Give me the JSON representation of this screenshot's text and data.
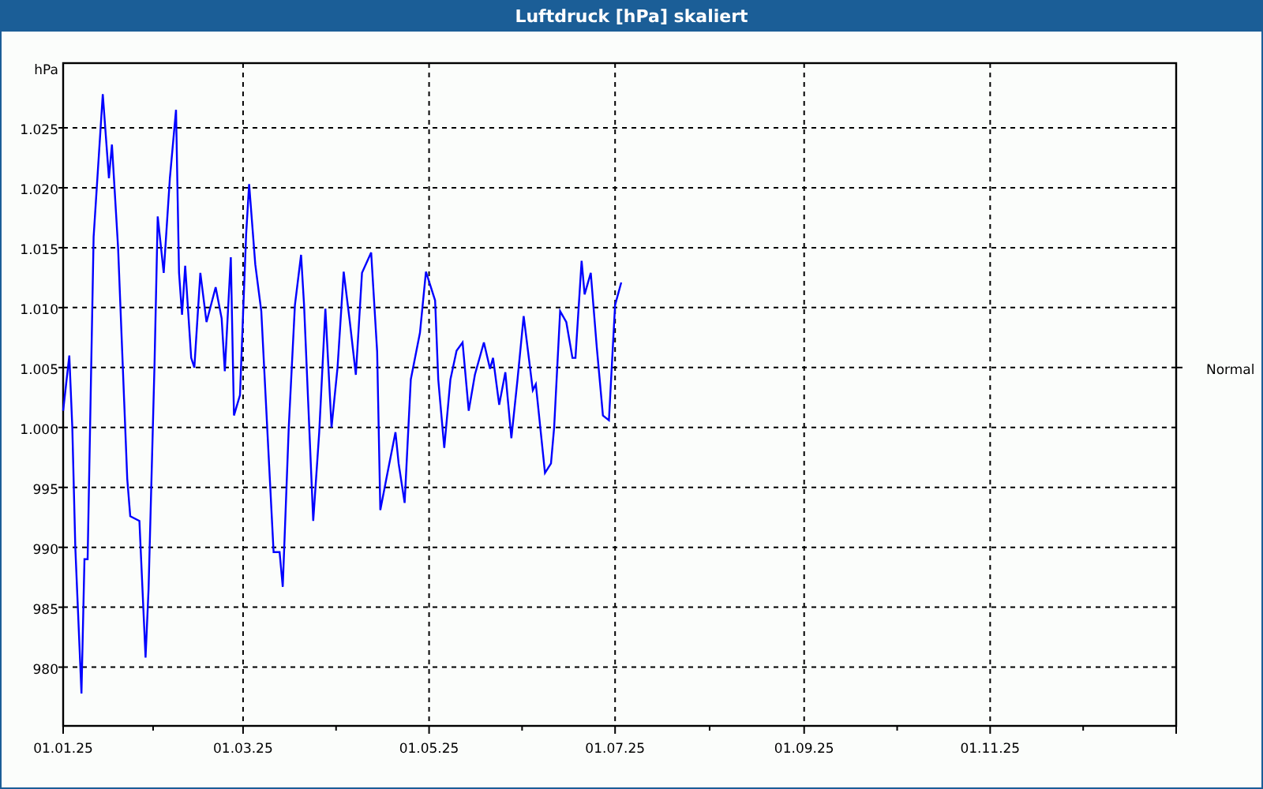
{
  "window": {
    "title": "Luftdruck [hPa] skaliert"
  },
  "chart": {
    "chart_data": {
      "type": "line",
      "ylabel": "hPa",
      "x": [
        "2025-01-01",
        "2025-01-03",
        "2025-01-04",
        "2025-01-05",
        "2025-01-07",
        "2025-01-08",
        "2025-01-09",
        "2025-01-11",
        "2025-01-14",
        "2025-01-16",
        "2025-01-17",
        "2025-01-19",
        "2025-01-22",
        "2025-01-23",
        "2025-01-26",
        "2025-01-28",
        "2025-01-29",
        "2025-01-31",
        "2025-02-01",
        "2025-02-03",
        "2025-02-05",
        "2025-02-07",
        "2025-02-08",
        "2025-02-09",
        "2025-02-10",
        "2025-02-12",
        "2025-02-13",
        "2025-02-15",
        "2025-02-17",
        "2025-02-20",
        "2025-02-22",
        "2025-02-23",
        "2025-02-25",
        "2025-02-26",
        "2025-02-28",
        "2025-03-02",
        "2025-03-03",
        "2025-03-05",
        "2025-03-07",
        "2025-03-09",
        "2025-03-11",
        "2025-03-13",
        "2025-03-14",
        "2025-03-16",
        "2025-03-18",
        "2025-03-20",
        "2025-03-21",
        "2025-03-24",
        "2025-03-26",
        "2025-03-28",
        "2025-03-30",
        "2025-04-01",
        "2025-04-03",
        "2025-04-05",
        "2025-04-07",
        "2025-04-09",
        "2025-04-12",
        "2025-04-14",
        "2025-04-15",
        "2025-04-17",
        "2025-04-20",
        "2025-04-21",
        "2025-04-23",
        "2025-04-25",
        "2025-04-28",
        "2025-04-30",
        "2025-05-03",
        "2025-05-04",
        "2025-05-06",
        "2025-05-08",
        "2025-05-10",
        "2025-05-12",
        "2025-05-14",
        "2025-05-16",
        "2025-05-19",
        "2025-05-21",
        "2025-05-22",
        "2025-05-24",
        "2025-05-26",
        "2025-05-28",
        "2025-05-30",
        "2025-06-01",
        "2025-06-04",
        "2025-06-05",
        "2025-06-08",
        "2025-06-10",
        "2025-06-11",
        "2025-06-13",
        "2025-06-15",
        "2025-06-17",
        "2025-06-18",
        "2025-06-20",
        "2025-06-21",
        "2025-06-23",
        "2025-06-25",
        "2025-06-27",
        "2025-06-29",
        "2025-07-01",
        "2025-07-03"
      ],
      "series": [
        {
          "color": "#0000ff",
          "values": [
            1001.4,
            1006,
            1000,
            990,
            977.8,
            989,
            989,
            1015.9,
            1027.8,
            1020.8,
            1023.6,
            1015,
            995.7,
            992.6,
            992.2,
            980.8,
            986.5,
            1005.4,
            1017.6,
            1012.9,
            1020.8,
            1026.5,
            1012.9,
            1009.4,
            1013.5,
            1005.8,
            1005,
            1012.9,
            1008.8,
            1011.7,
            1009.1,
            1004.7,
            1014.2,
            1001,
            1002.7,
            1016.1,
            1020.3,
            1013.6,
            1009.7,
            999.6,
            989.6,
            989.6,
            986.7,
            1000,
            1010.2,
            1014.4,
            1010.2,
            992.2,
            999.6,
            1009.9,
            1000,
            1005,
            1013,
            1008.8,
            1004.4,
            1012.9,
            1014.6,
            1006.3,
            993.1,
            995.7,
            999.6,
            997,
            993.7,
            1004,
            1007.9,
            1013,
            1010.6,
            1004,
            998.3,
            1004,
            1006.4,
            1007.1,
            1001.4,
            1004.4,
            1007.1,
            1004.9,
            1005.8,
            1001.9,
            1004.6,
            999.1,
            1004,
            1009.3,
            1003.1,
            1003.6,
            996.2,
            997,
            1000,
            1009.7,
            1008.8,
            1005.8,
            1005.8,
            1013.9,
            1011.1,
            1012.9,
            1006.7,
            1001,
            1000.6,
            1010.2,
            1012.1
          ]
        }
      ],
      "xlim": [
        "2025-01-01",
        "2026-01-01"
      ],
      "ylim": [
        975.1,
        1030.4
      ],
      "xticks": [
        {
          "value": "2025-01-01",
          "label": "01.01.25"
        },
        {
          "value": "2025-03-01",
          "label": "01.03.25"
        },
        {
          "value": "2025-05-01",
          "label": "01.05.25"
        },
        {
          "value": "2025-07-01",
          "label": "01.07.25"
        },
        {
          "value": "2025-09-01",
          "label": "01.09.25"
        },
        {
          "value": "2025-11-01",
          "label": "01.11.25"
        }
      ],
      "yticks": [
        {
          "value": 980,
          "label": "980"
        },
        {
          "value": 985,
          "label": "985"
        },
        {
          "value": 990,
          "label": "990"
        },
        {
          "value": 995,
          "label": "995"
        },
        {
          "value": 1000,
          "label": "1.000"
        },
        {
          "value": 1005,
          "label": "1.005"
        },
        {
          "value": 1010,
          "label": "1.010"
        },
        {
          "value": 1015,
          "label": "1.015"
        },
        {
          "value": 1020,
          "label": "1.020"
        },
        {
          "value": 1025,
          "label": "1.025"
        }
      ],
      "grid": true,
      "annotations": [
        "Normal"
      ]
    }
  }
}
